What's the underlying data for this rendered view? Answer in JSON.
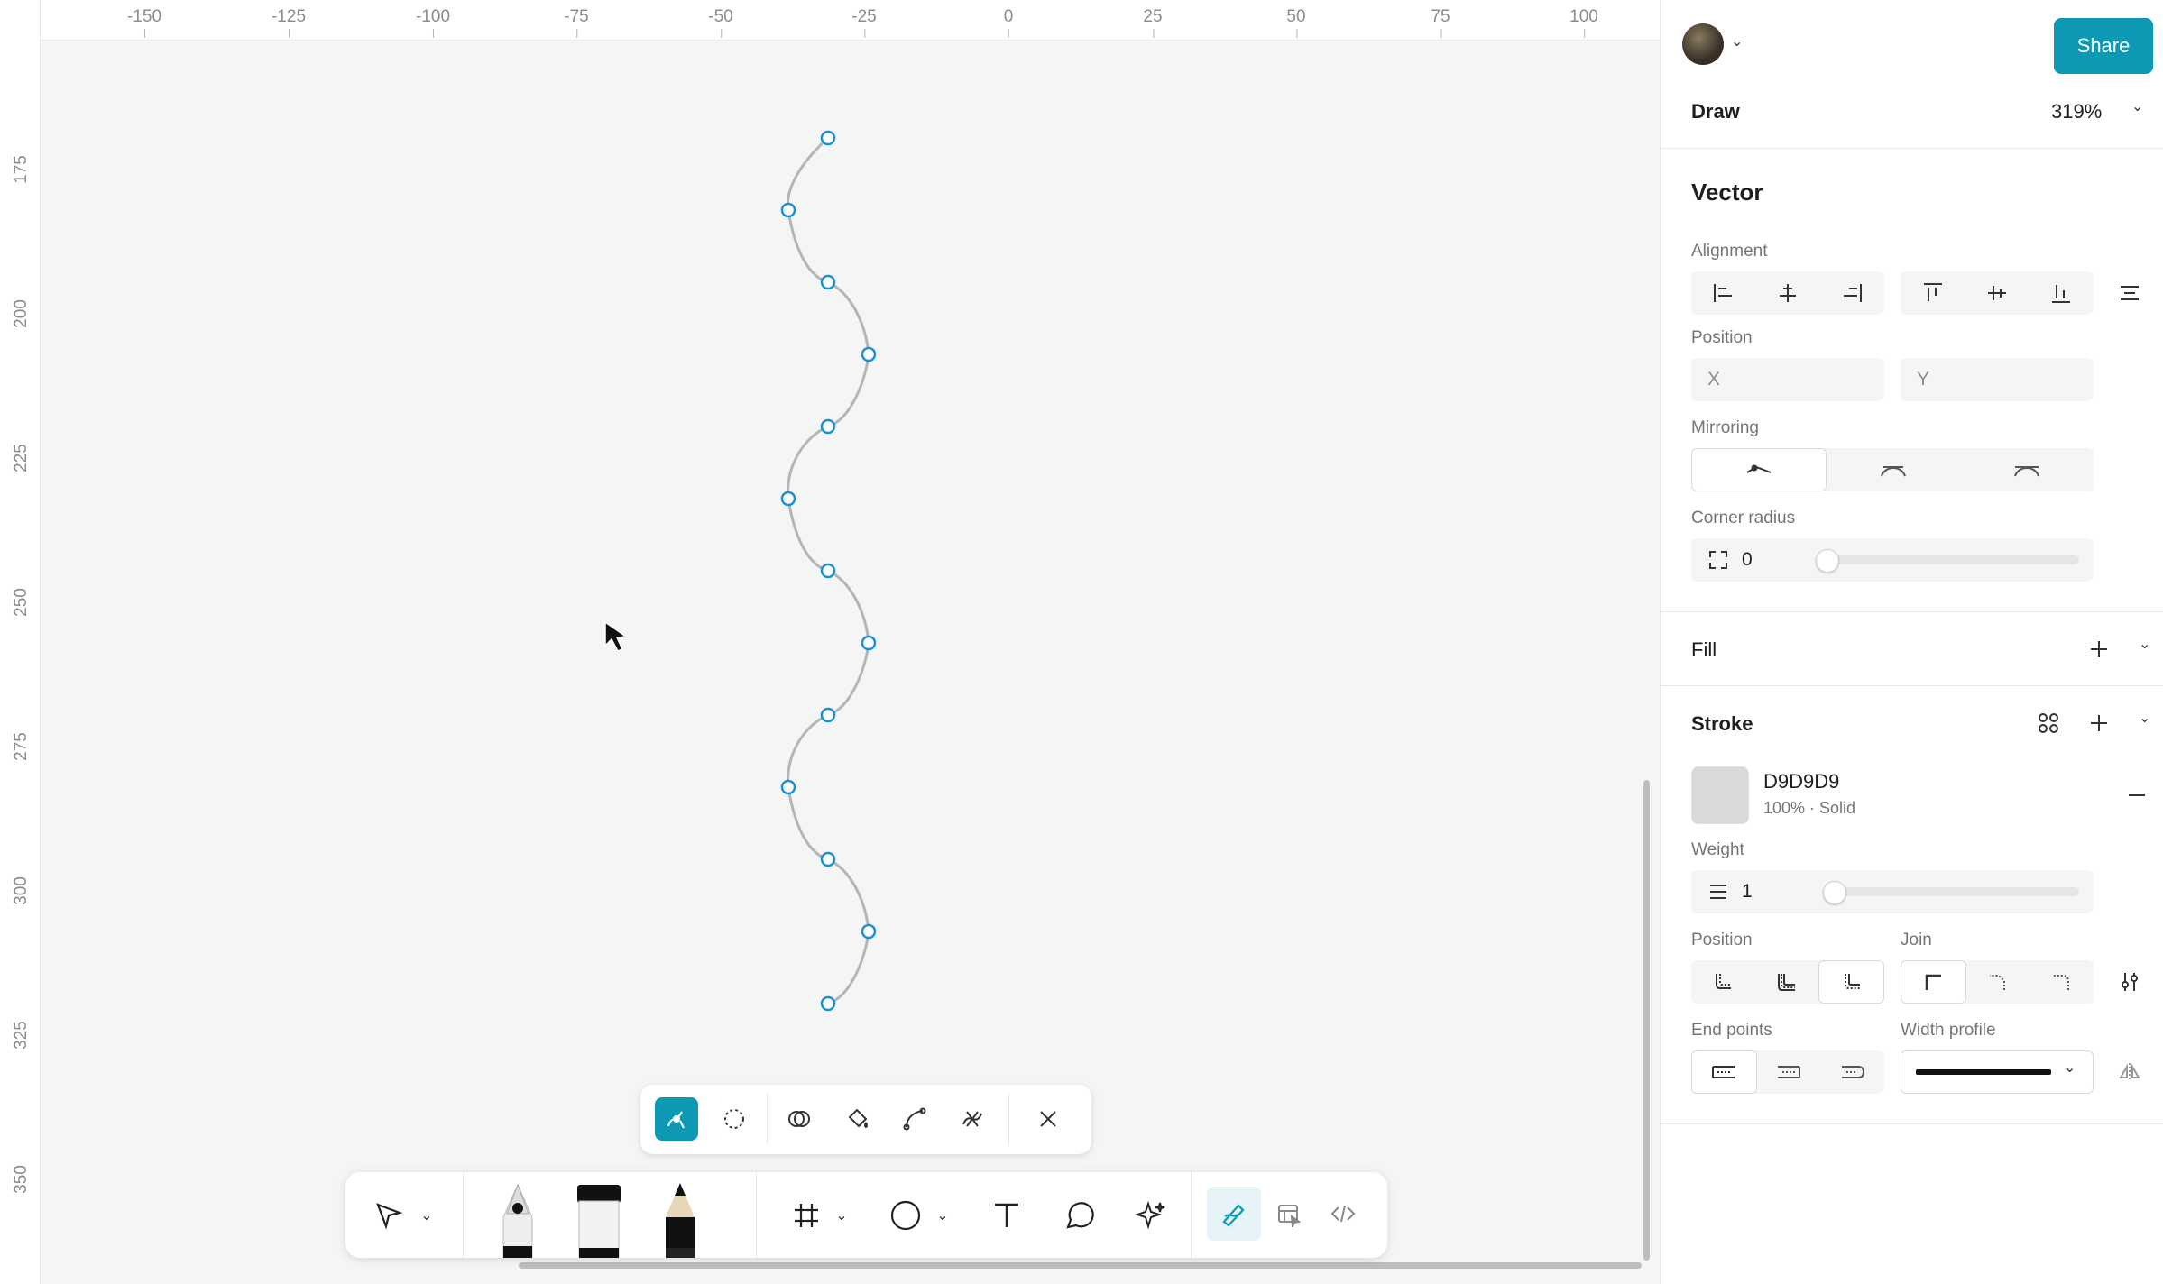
{
  "ruler": {
    "x_ticks": [
      "-150",
      "-125",
      "-100",
      "-75",
      "-50",
      "-25",
      "0",
      "25",
      "50",
      "75",
      "100"
    ],
    "y_ticks": [
      "175",
      "200",
      "225",
      "250",
      "275",
      "300",
      "325",
      "350"
    ]
  },
  "header": {
    "share_label": "Share",
    "mode_label": "Draw",
    "zoom_label": "319%"
  },
  "vector": {
    "title": "Vector",
    "alignment_label": "Alignment",
    "position_label": "Position",
    "x_placeholder": "X",
    "y_placeholder": "Y",
    "mirroring_label": "Mirroring",
    "corner_radius_label": "Corner radius",
    "corner_radius_value": "0"
  },
  "fill": {
    "title": "Fill"
  },
  "stroke": {
    "title": "Stroke",
    "color_hex": "D9D9D9",
    "color_meta": "100% · Solid",
    "swatch_color": "#d9d9d9",
    "weight_label": "Weight",
    "weight_value": "1",
    "position_label": "Position",
    "join_label": "Join",
    "end_points_label": "End points",
    "width_profile_label": "Width profile"
  },
  "colors": {
    "accent": "#0d99b4",
    "anchor": "#1a8fd6",
    "path": "#b5b5b5"
  }
}
